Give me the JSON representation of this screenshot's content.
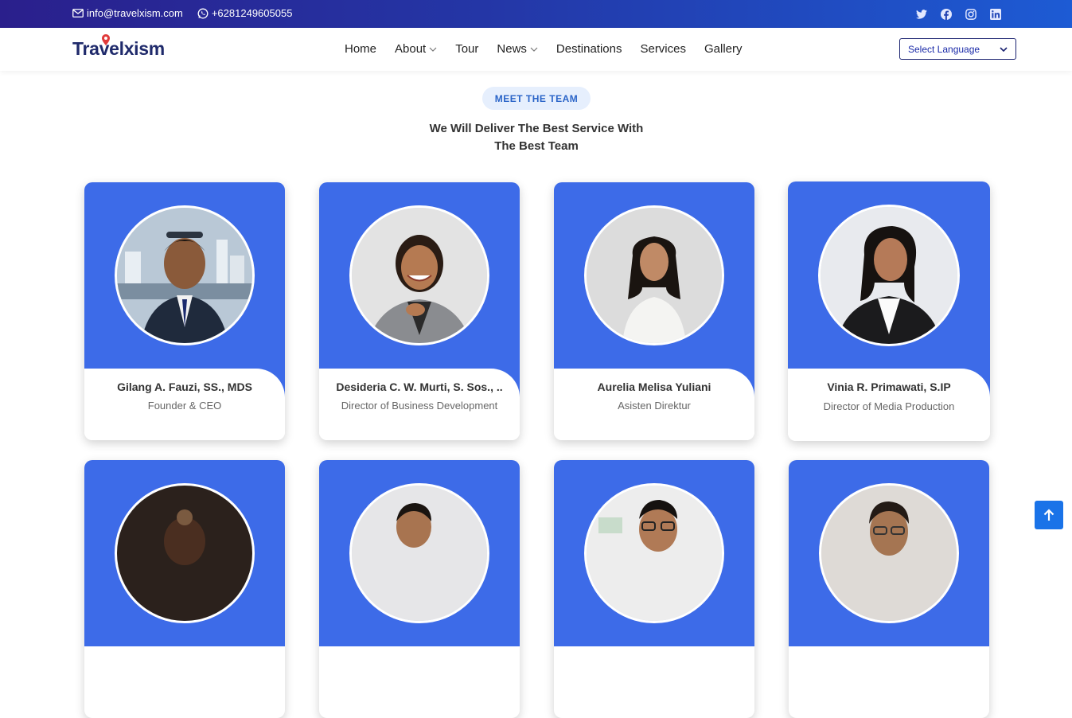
{
  "topbar": {
    "email": "info@travelxism.com",
    "phone": "+6281249605055",
    "social": [
      "twitter-icon",
      "facebook-icon",
      "instagram-icon",
      "linkedin-icon"
    ]
  },
  "nav": {
    "logo": "Travelxism",
    "items": [
      {
        "label": "Home",
        "dropdown": false
      },
      {
        "label": "About",
        "dropdown": true
      },
      {
        "label": "Tour",
        "dropdown": false
      },
      {
        "label": "News",
        "dropdown": true
      },
      {
        "label": "Destinations",
        "dropdown": false
      },
      {
        "label": "Services",
        "dropdown": false
      },
      {
        "label": "Gallery",
        "dropdown": false
      }
    ],
    "language_select": "Select Language"
  },
  "section": {
    "badge": "MEET THE TEAM",
    "subtitle_line1": "We Will Deliver The Best Service With",
    "subtitle_line2": "The Best Team"
  },
  "team": [
    {
      "name": "Gilang A. Fauzi, SS., MDS",
      "role": "Founder & CEO"
    },
    {
      "name": "Desideria C. W. Murti, S. Sos., ..",
      "role": "Director of Business Development"
    },
    {
      "name": "Aurelia Melisa Yuliani",
      "role": "Asisten Direktur"
    },
    {
      "name": "Vinia R. Primawati, S.IP",
      "role": "Director of Media Production"
    },
    {
      "name": "",
      "role": ""
    },
    {
      "name": "",
      "role": ""
    },
    {
      "name": "",
      "role": ""
    },
    {
      "name": "",
      "role": ""
    }
  ],
  "colors": {
    "accent": "#3d6be8",
    "topbar_start": "#2a1f8c",
    "topbar_end": "#1d5bd4",
    "back_to_top": "#1a73e8"
  }
}
